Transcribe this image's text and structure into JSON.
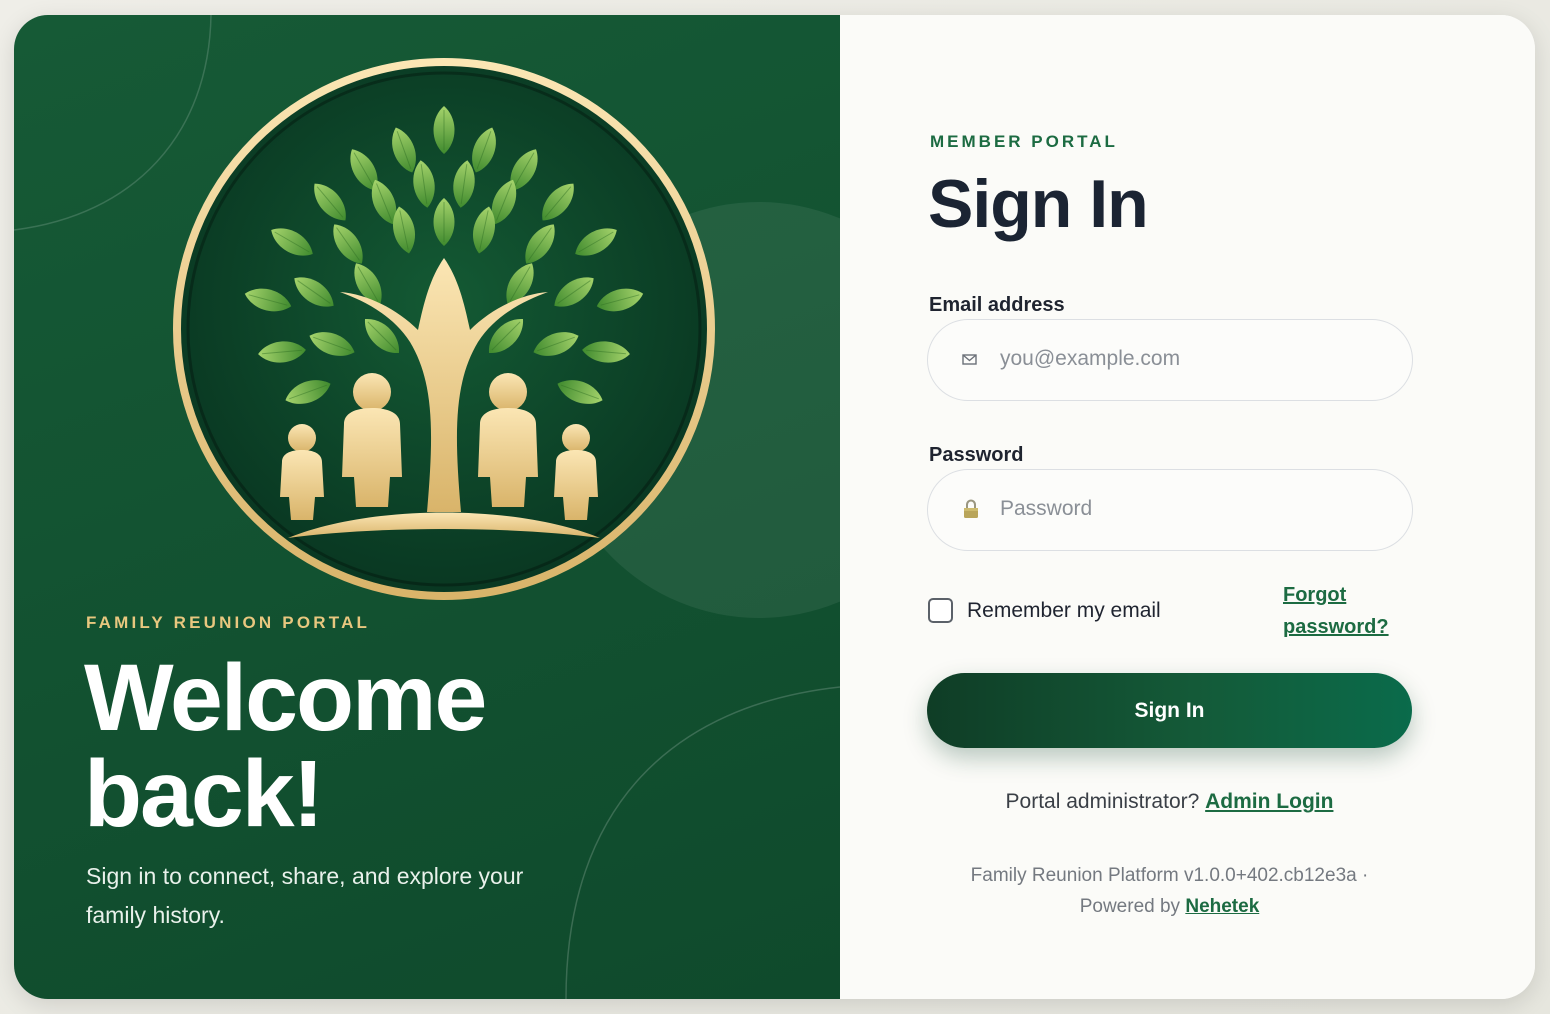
{
  "branding": {
    "eyebrow": "FAMILY REUNION PORTAL",
    "headline_line1": "Welcome",
    "headline_line2": "back!",
    "subtitle": "Sign in to connect, share, and explore your family history.",
    "logo_icon": "family-tree-logo-icon"
  },
  "form": {
    "eyebrow": "MEMBER PORTAL",
    "title": "Sign In",
    "email": {
      "label": "Email address",
      "placeholder": "you@example.com",
      "value": "",
      "icon": "envelope-icon"
    },
    "password": {
      "label": "Password",
      "placeholder": "Password",
      "value": "",
      "icon": "lock-icon"
    },
    "remember_label": "Remember my email",
    "remember_checked": false,
    "forgot_label": "Forgot password?",
    "submit_label": "Sign In",
    "admin_prompt": "Portal administrator?",
    "admin_link": "Admin Login"
  },
  "footer": {
    "platform": "Family Reunion Platform v1.0.0+402.cb12e3a ·",
    "powered_by": "Powered by",
    "vendor": "Nehetek"
  },
  "colors": {
    "brand_green": "#165a36",
    "accent_gold": "#e8c77f",
    "link_green": "#1c6b42",
    "title_navy": "#1b2433"
  }
}
